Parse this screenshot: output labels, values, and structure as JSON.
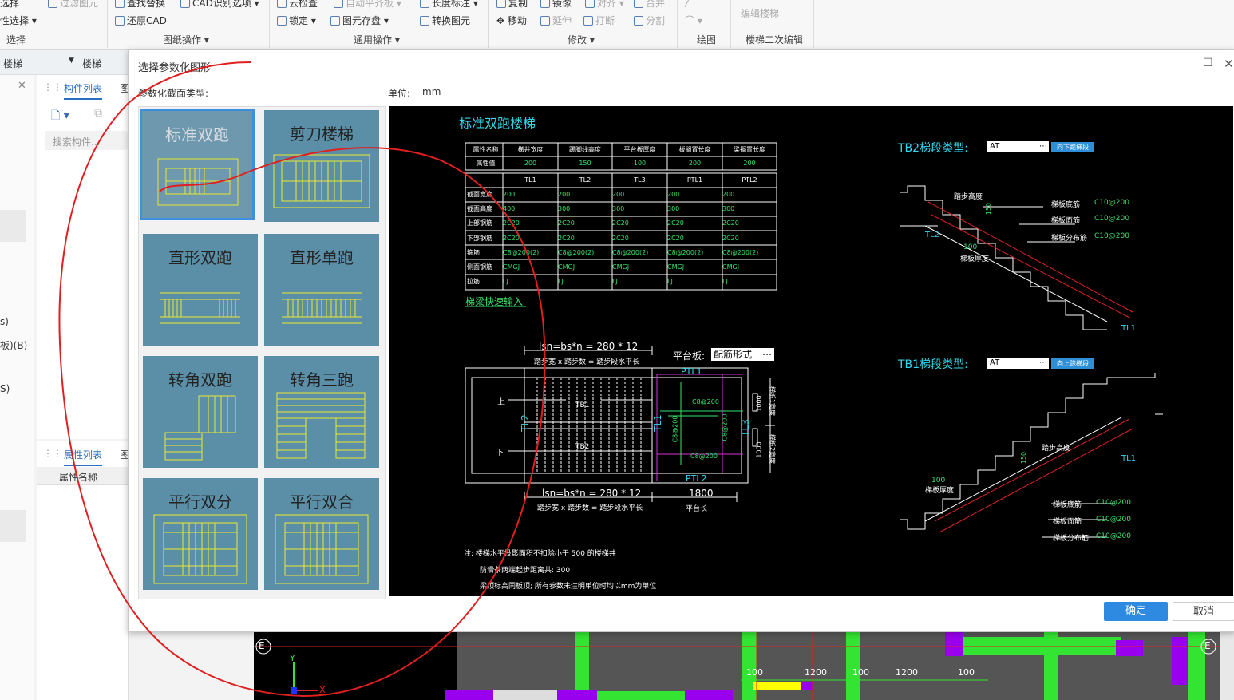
{
  "ribbon": {
    "row1": [
      "选择",
      "过滤图元",
      "查找替换",
      "CAD识别选项",
      "云检查",
      "自动平齐板",
      "长度标注",
      "复制",
      "镜像",
      "对齐",
      "合并"
    ],
    "row2": [
      "性选择",
      "还原CAD",
      "锁定",
      "图元存盘",
      "转换图元",
      "移动",
      "延伸",
      "打断",
      "分割"
    ],
    "groups": [
      "选择",
      "图纸操作",
      "通用操作",
      "修改",
      "绘图",
      "楼梯二次编辑"
    ],
    "edit_stair": "编辑楼梯"
  },
  "left": {
    "combo1": "楼梯",
    "combo2": "楼梯",
    "tab_components": "构件列表",
    "tab_props": "属性列表",
    "tab_other": "图",
    "search_placeholder": "搜索构件...",
    "prop_header": "属性名称",
    "side_labels": [
      "s)",
      "板)(B)",
      "S)"
    ]
  },
  "dialog": {
    "title": "选择参数化图形",
    "section_label": "参数化截面类型:",
    "unit_label": "单位:",
    "unit_value": "mm",
    "ok": "确定",
    "cancel": "取消",
    "types": [
      "标准双跑",
      "剪刀楼梯",
      "直形双跑",
      "直形单跑",
      "转角双跑",
      "转角三跑",
      "平行双分",
      "平行双合"
    ]
  },
  "preview": {
    "title": "标准双跑楼梯",
    "table1_headers": [
      "属性名称",
      "梯井宽度",
      "踢脚线高度",
      "平台板厚度",
      "板搁置长度",
      "梁搁置长度"
    ],
    "table1_values": [
      "属性值",
      "200",
      "150",
      "100",
      "200",
      "200"
    ],
    "table2_headers": [
      "",
      "TL1",
      "TL2",
      "TL3",
      "PTL1",
      "PTL2"
    ],
    "table2_rows": [
      [
        "截面宽度",
        "200",
        "200",
        "200",
        "200",
        "200"
      ],
      [
        "截面高度",
        "400",
        "300",
        "300",
        "300",
        "300"
      ],
      [
        "上部钢筋",
        "2C20",
        "2C20",
        "2C20",
        "2C20",
        "2C20"
      ],
      [
        "下部钢筋",
        "2C20",
        "2C20",
        "2C20",
        "2C20",
        "2C20"
      ],
      [
        "箍筋",
        "C8@200(2)",
        "C8@200(2)",
        "C8@200(2)",
        "C8@200(2)",
        "C8@200(2)"
      ],
      [
        "侧面钢筋",
        "CMGJ",
        "CMGJ",
        "CMGJ",
        "CMGJ",
        "CMGJ"
      ],
      [
        "拉筋",
        "LJ",
        "LJ",
        "LJ",
        "LJ",
        "LJ"
      ]
    ],
    "quick_input": "梯梁快速输入",
    "formula_top": "lsn=bs*n = 280 * 12",
    "formula_top_sub": "踏步宽 x 踏步数 = 踏步段水平长",
    "formula_bot": "lsn=bs*n = 280 * 12",
    "formula_bot_sub": "踏步宽 x 踏步数 = 踏步段水平长",
    "platform_label": "平台板:",
    "platform_value": "配筋形式",
    "platform_len": "1800",
    "platform_len_label": "平台长",
    "plan_labels": {
      "up": "上",
      "down": "下",
      "tb1": "TB1",
      "tb2": "TB2",
      "tl1": "TL1",
      "tl2": "TL2",
      "tl3": "TL3",
      "ptl1": "PTL1",
      "ptl2": "PTL2",
      "c8a": "C8@200",
      "c8b": "C8@200",
      "c8c": "C8@200",
      "c8d": "C8@200",
      "dim1": "1000",
      "dim2": "1000",
      "w1": "梯板1宽度",
      "w2": "梯板2宽度"
    },
    "notes": [
      "注: 楼梯水平投影面积不扣除小于 500 的楼梯井",
      "防滑条两端起步距离共: 300",
      "梁顶标高同板顶; 所有参数未注明单位时均以mm为单位"
    ],
    "tb2": {
      "label": "TB2梯段类型:",
      "value": "AT",
      "btn": "向下跑梯段",
      "step_h": "踏步高度",
      "v150": "150",
      "v100": "100",
      "thick": "梯板厚度",
      "bot": "梯板底筋",
      "top": "梯板面筋",
      "dist": "梯板分布筋",
      "c1": "C10@200",
      "c2": "C10@200",
      "c3": "C10@200",
      "tl2": "TL2",
      "tl1": "TL1"
    },
    "tb1": {
      "label": "TB1梯段类型:",
      "value": "AT",
      "btn": "向上跑梯段",
      "step_h": "踏步高度",
      "v150": "150",
      "v100": "100",
      "thick": "梯板厚度",
      "bot": "梯板底筋",
      "top": "梯板面筋",
      "dist": "梯板分布筋",
      "c1": "C10@200",
      "c2": "C10@200",
      "c3": "C10@200",
      "tl1": "TL1"
    }
  },
  "cad": {
    "axis_e": "E",
    "dims": [
      "100",
      "1200",
      "100",
      "1200",
      "100"
    ],
    "axis_x": "X",
    "axis_y": "Y"
  }
}
